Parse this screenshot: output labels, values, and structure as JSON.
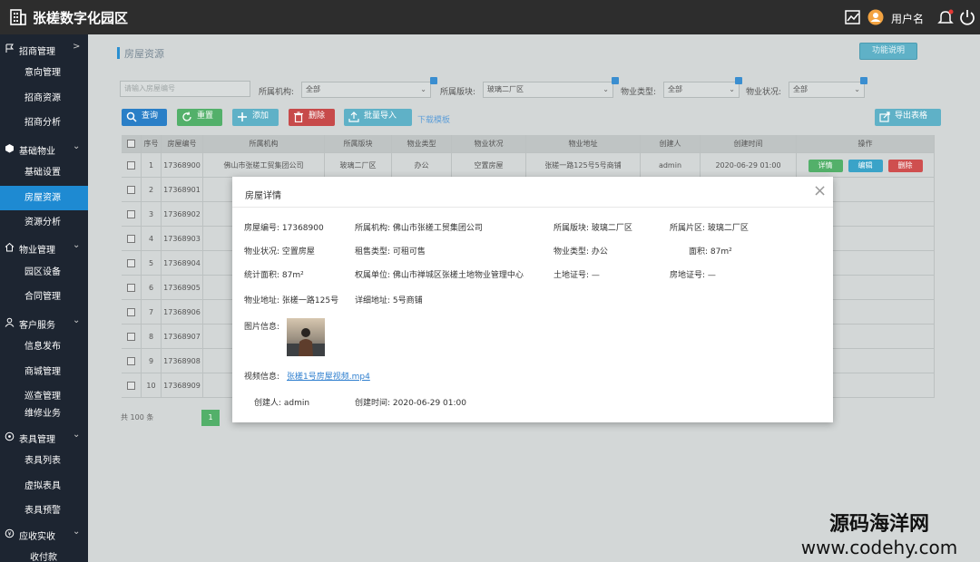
{
  "app": {
    "title": "张槎数字化园区",
    "user_name": "用户名"
  },
  "sidebar": {
    "groups": [
      {
        "label": "招商管理",
        "chevron": ">",
        "items": [
          "意向管理",
          "招商资源",
          "招商分析"
        ]
      },
      {
        "label": "基础物业",
        "chevron": "⌄",
        "items": [
          "基础设置",
          "房屋资源",
          "资源分析"
        ]
      },
      {
        "label": "物业管理",
        "chevron": "⌄",
        "items": [
          "园区设备",
          "合同管理"
        ]
      },
      {
        "label": "客户服务",
        "chevron": "⌄",
        "items": [
          "信息发布",
          "商城管理",
          "巡查管理",
          "维修业务"
        ]
      },
      {
        "label": "表具管理",
        "chevron": "⌄",
        "items": [
          "表具列表",
          "虚拟表具",
          "表具预警"
        ]
      },
      {
        "label": "应收实收",
        "chevron": "⌄",
        "items": [
          "收付款"
        ]
      }
    ],
    "active_item": "房屋资源"
  },
  "page": {
    "title": "房屋资源",
    "help_button": "功能说明"
  },
  "filters": {
    "search_placeholder": "请输入房屋编号",
    "org_label": "所属机构:",
    "org_value": "全部",
    "block_label": "所属版块:",
    "block_value": "玻璃二厂区",
    "type_label": "物业类型:",
    "type_value": "全部",
    "status_label": "物业状况:",
    "status_value": "全部"
  },
  "toolbar": {
    "query": "查询",
    "reset": "重置",
    "add": "添加",
    "delete": "删除",
    "import": "批量导入",
    "download_template": "下载模板",
    "export": "导出表格"
  },
  "table": {
    "headers": [
      "",
      "序号",
      "房屋编号",
      "所属机构",
      "所属版块",
      "物业类型",
      "物业状况",
      "物业地址",
      "创建人",
      "创建时间",
      "操作"
    ],
    "rows": [
      [
        "1",
        "17368900",
        "佛山市张槎工贸集团公司",
        "玻璃二厂区",
        "办公",
        "空置房屋",
        "张槎一路125号5号商铺",
        "admin",
        "2020-06-29  01:00"
      ],
      [
        "2",
        "17368901"
      ],
      [
        "3",
        "17368902"
      ],
      [
        "4",
        "17368903"
      ],
      [
        "5",
        "17368904"
      ],
      [
        "6",
        "17368905"
      ],
      [
        "7",
        "17368906"
      ],
      [
        "8",
        "17368907"
      ],
      [
        "9",
        "17368908"
      ],
      [
        "10",
        "17368909"
      ]
    ],
    "actions": {
      "detail": "详情",
      "edit": "编辑",
      "delete": "删除"
    }
  },
  "pagination": {
    "total": "共 100 条",
    "current_page": "1"
  },
  "modal": {
    "title": "房屋详情",
    "close": "×",
    "fields": {
      "house_no": "房屋编号: 17368900",
      "org": "所属机构: 佛山市张槎工贸集团公司",
      "block": "所属版块: 玻璃二厂区",
      "zone": "所属片区: 玻璃二厂区",
      "status": "物业状况: 空置房屋",
      "rent_type": "租售类型: 可租可售",
      "prop_type": "物业类型: 办公",
      "area": "面积: 87m²",
      "stat_area": "统计面积: 87m²",
      "owner": "权属单位: 佛山市禅城区张槎土地物业管理中心",
      "land_cert": "土地证号: —",
      "house_cert": "房地证号: —",
      "address": "物业地址: 张槎一路125号",
      "detail_addr": "详细地址: 5号商铺",
      "image_label": "图片信息:",
      "video_label": "视频信息:",
      "video_link": "张槎1号房屋视频.mp4",
      "creator": "创建人: admin",
      "create_time": "创建时间: 2020-06-29  01:00"
    }
  },
  "watermark": {
    "line1": "源码海洋网",
    "line2": "www.codehy.com"
  },
  "colors": {
    "topbar": "#2d2d2d",
    "sidebar": "#1d2531",
    "sidebar_active": "#1e8ad2",
    "btn_query": "#2a7fc7",
    "btn_reset": "#53b06a",
    "btn_add": "#5fb1c7",
    "btn_delete": "#c74a4a",
    "btn_import": "#5fb1c7",
    "btn_export": "#5fb1c7",
    "act_detail": "#53b06a",
    "act_edit": "#3aa3c8",
    "act_delete": "#cf4f4f"
  }
}
